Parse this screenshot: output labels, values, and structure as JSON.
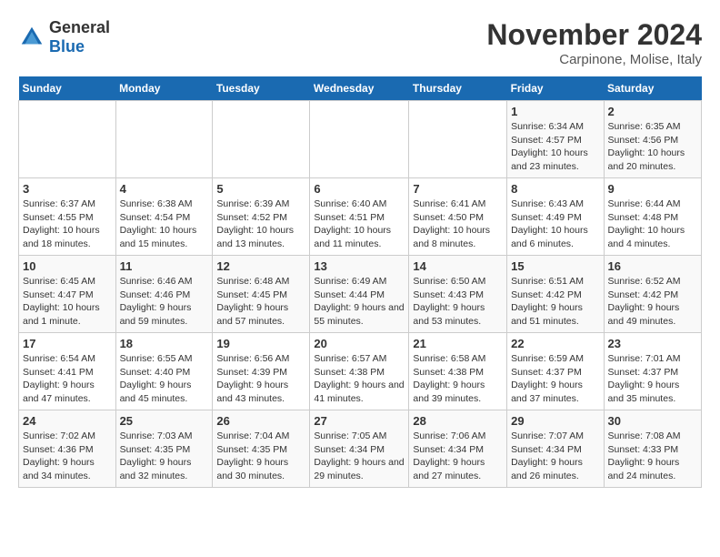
{
  "header": {
    "logo_general": "General",
    "logo_blue": "Blue",
    "month_title": "November 2024",
    "subtitle": "Carpinone, Molise, Italy"
  },
  "weekdays": [
    "Sunday",
    "Monday",
    "Tuesday",
    "Wednesday",
    "Thursday",
    "Friday",
    "Saturday"
  ],
  "weeks": [
    [
      {
        "day": "",
        "info": ""
      },
      {
        "day": "",
        "info": ""
      },
      {
        "day": "",
        "info": ""
      },
      {
        "day": "",
        "info": ""
      },
      {
        "day": "",
        "info": ""
      },
      {
        "day": "1",
        "info": "Sunrise: 6:34 AM\nSunset: 4:57 PM\nDaylight: 10 hours and 23 minutes."
      },
      {
        "day": "2",
        "info": "Sunrise: 6:35 AM\nSunset: 4:56 PM\nDaylight: 10 hours and 20 minutes."
      }
    ],
    [
      {
        "day": "3",
        "info": "Sunrise: 6:37 AM\nSunset: 4:55 PM\nDaylight: 10 hours and 18 minutes."
      },
      {
        "day": "4",
        "info": "Sunrise: 6:38 AM\nSunset: 4:54 PM\nDaylight: 10 hours and 15 minutes."
      },
      {
        "day": "5",
        "info": "Sunrise: 6:39 AM\nSunset: 4:52 PM\nDaylight: 10 hours and 13 minutes."
      },
      {
        "day": "6",
        "info": "Sunrise: 6:40 AM\nSunset: 4:51 PM\nDaylight: 10 hours and 11 minutes."
      },
      {
        "day": "7",
        "info": "Sunrise: 6:41 AM\nSunset: 4:50 PM\nDaylight: 10 hours and 8 minutes."
      },
      {
        "day": "8",
        "info": "Sunrise: 6:43 AM\nSunset: 4:49 PM\nDaylight: 10 hours and 6 minutes."
      },
      {
        "day": "9",
        "info": "Sunrise: 6:44 AM\nSunset: 4:48 PM\nDaylight: 10 hours and 4 minutes."
      }
    ],
    [
      {
        "day": "10",
        "info": "Sunrise: 6:45 AM\nSunset: 4:47 PM\nDaylight: 10 hours and 1 minute."
      },
      {
        "day": "11",
        "info": "Sunrise: 6:46 AM\nSunset: 4:46 PM\nDaylight: 9 hours and 59 minutes."
      },
      {
        "day": "12",
        "info": "Sunrise: 6:48 AM\nSunset: 4:45 PM\nDaylight: 9 hours and 57 minutes."
      },
      {
        "day": "13",
        "info": "Sunrise: 6:49 AM\nSunset: 4:44 PM\nDaylight: 9 hours and 55 minutes."
      },
      {
        "day": "14",
        "info": "Sunrise: 6:50 AM\nSunset: 4:43 PM\nDaylight: 9 hours and 53 minutes."
      },
      {
        "day": "15",
        "info": "Sunrise: 6:51 AM\nSunset: 4:42 PM\nDaylight: 9 hours and 51 minutes."
      },
      {
        "day": "16",
        "info": "Sunrise: 6:52 AM\nSunset: 4:42 PM\nDaylight: 9 hours and 49 minutes."
      }
    ],
    [
      {
        "day": "17",
        "info": "Sunrise: 6:54 AM\nSunset: 4:41 PM\nDaylight: 9 hours and 47 minutes."
      },
      {
        "day": "18",
        "info": "Sunrise: 6:55 AM\nSunset: 4:40 PM\nDaylight: 9 hours and 45 minutes."
      },
      {
        "day": "19",
        "info": "Sunrise: 6:56 AM\nSunset: 4:39 PM\nDaylight: 9 hours and 43 minutes."
      },
      {
        "day": "20",
        "info": "Sunrise: 6:57 AM\nSunset: 4:38 PM\nDaylight: 9 hours and 41 minutes."
      },
      {
        "day": "21",
        "info": "Sunrise: 6:58 AM\nSunset: 4:38 PM\nDaylight: 9 hours and 39 minutes."
      },
      {
        "day": "22",
        "info": "Sunrise: 6:59 AM\nSunset: 4:37 PM\nDaylight: 9 hours and 37 minutes."
      },
      {
        "day": "23",
        "info": "Sunrise: 7:01 AM\nSunset: 4:37 PM\nDaylight: 9 hours and 35 minutes."
      }
    ],
    [
      {
        "day": "24",
        "info": "Sunrise: 7:02 AM\nSunset: 4:36 PM\nDaylight: 9 hours and 34 minutes."
      },
      {
        "day": "25",
        "info": "Sunrise: 7:03 AM\nSunset: 4:35 PM\nDaylight: 9 hours and 32 minutes."
      },
      {
        "day": "26",
        "info": "Sunrise: 7:04 AM\nSunset: 4:35 PM\nDaylight: 9 hours and 30 minutes."
      },
      {
        "day": "27",
        "info": "Sunrise: 7:05 AM\nSunset: 4:34 PM\nDaylight: 9 hours and 29 minutes."
      },
      {
        "day": "28",
        "info": "Sunrise: 7:06 AM\nSunset: 4:34 PM\nDaylight: 9 hours and 27 minutes."
      },
      {
        "day": "29",
        "info": "Sunrise: 7:07 AM\nSunset: 4:34 PM\nDaylight: 9 hours and 26 minutes."
      },
      {
        "day": "30",
        "info": "Sunrise: 7:08 AM\nSunset: 4:33 PM\nDaylight: 9 hours and 24 minutes."
      }
    ]
  ]
}
